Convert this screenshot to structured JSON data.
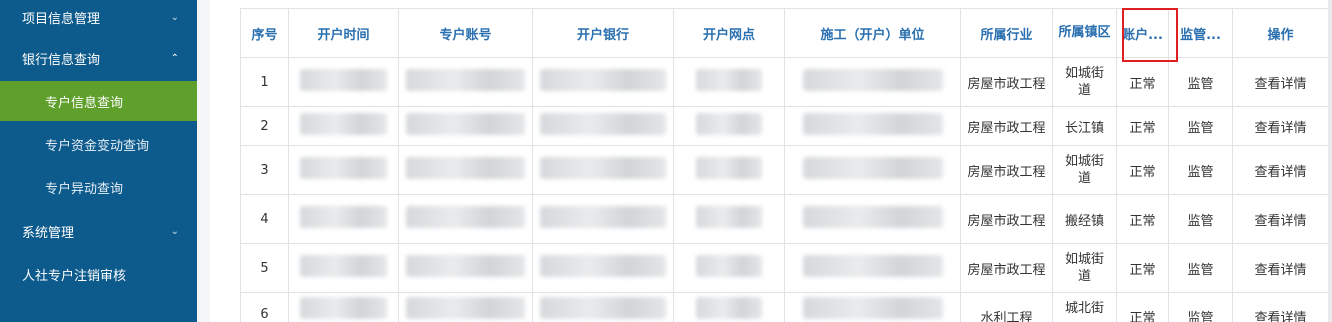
{
  "sidebar": {
    "items": [
      {
        "label": "项目信息管理",
        "level": "top",
        "chevron": "⌄",
        "chevron_icon": "chevron-down-icon"
      },
      {
        "label": "银行信息查询",
        "level": "top",
        "chevron": "⌃",
        "chevron_icon": "chevron-up-icon",
        "expanded": true
      },
      {
        "label": "专户信息查询",
        "level": "sub",
        "active": true
      },
      {
        "label": "专户资金变动查询",
        "level": "sub"
      },
      {
        "label": "专户异动查询",
        "level": "sub"
      },
      {
        "label": "系统管理",
        "level": "top",
        "chevron": "⌄",
        "chevron_icon": "chevron-down-icon"
      },
      {
        "label": "人社专户注销审核",
        "level": "top"
      }
    ],
    "active_color": "#5f9f2b",
    "bg_color": "#0d5a8c"
  },
  "table": {
    "headers": [
      "序号",
      "开户时间",
      "专户账号",
      "开户银行",
      "开户网点",
      "施工（开户）单位",
      "所属行业",
      "所属镇区",
      "账户...",
      "监管...",
      "操作"
    ],
    "rows": [
      {
        "no": "1",
        "industry": "房屋市政工程",
        "town": "如城街道",
        "status": "正常",
        "supervise": "监管",
        "action": "查看详情"
      },
      {
        "no": "2",
        "industry": "房屋市政工程",
        "town": "长江镇",
        "status": "正常",
        "supervise": "监管",
        "action": "查看详情"
      },
      {
        "no": "3",
        "industry": "房屋市政工程",
        "town": "如城街道",
        "status": "正常",
        "supervise": "监管",
        "action": "查看详情"
      },
      {
        "no": "4",
        "industry": "房屋市政工程",
        "town": "搬经镇",
        "status": "正常",
        "supervise": "监管",
        "action": "查看详情"
      },
      {
        "no": "5",
        "industry": "房屋市政工程",
        "town": "如城街道",
        "status": "正常",
        "supervise": "监管",
        "action": "查看详情"
      },
      {
        "no": "6",
        "industry": "水利工程",
        "town": "城北街",
        "status": "正常",
        "supervise": "监管",
        "action": "查看详情"
      }
    ],
    "header_color": "#2a6fb0",
    "status_color": "#2e9b27",
    "link_color": "#2a74c4",
    "highlight_color": "#e02020"
  }
}
